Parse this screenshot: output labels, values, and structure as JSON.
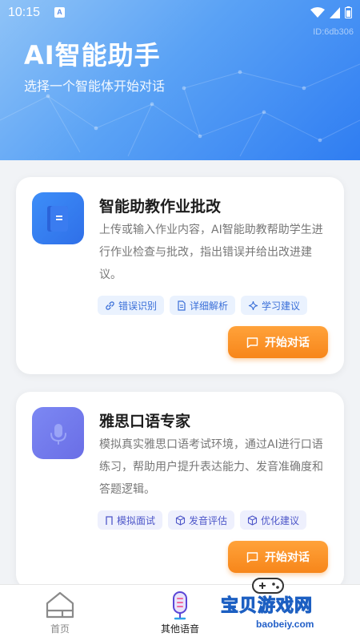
{
  "status_bar": {
    "time": "10:15",
    "indicator": "A"
  },
  "header": {
    "app_id": "ID:6db306",
    "title": "AI智能助手",
    "subtitle": "选择一个智能体开始对话"
  },
  "agents": [
    {
      "title": "智能助教作业批改",
      "description": "上传或输入作业内容，AI智能助教帮助学生进行作业检查与批改，指出错误并给出改进建议。",
      "icon": "document-icon",
      "accent": "#3d8ef8",
      "tags": [
        {
          "label": "错误识别",
          "icon": "link-icon"
        },
        {
          "label": "详细解析",
          "icon": "file-text-icon"
        },
        {
          "label": "学习建议",
          "icon": "sparkle-icon"
        }
      ],
      "button_label": "开始对话"
    },
    {
      "title": "雅思口语专家",
      "description": "模拟真实雅思口语考试环境，通过AI进行口语练习，帮助用户提升表达能力、发音准确度和答题逻辑。",
      "icon": "microphone-icon",
      "accent": "#7c88f3",
      "tags": [
        {
          "label": "模拟面试",
          "icon": "bookmark-icon"
        },
        {
          "label": "发音评估",
          "icon": "cube-icon"
        },
        {
          "label": "优化建议",
          "icon": "cube-icon"
        }
      ],
      "button_label": "开始对话"
    }
  ],
  "bottom_nav": {
    "items": [
      {
        "label": "首页",
        "icon": "home-icon",
        "active": false
      },
      {
        "label": "其他语音",
        "icon": "voice-icon",
        "active": true
      }
    ]
  },
  "watermark": {
    "text": "宝贝游戏网",
    "url": "baobeiy.com"
  },
  "colors": {
    "header_gradient_start": "#8fc3f7",
    "header_gradient_end": "#2f7df2",
    "button_orange": "#f7861a",
    "background": "#f1f3f6"
  }
}
